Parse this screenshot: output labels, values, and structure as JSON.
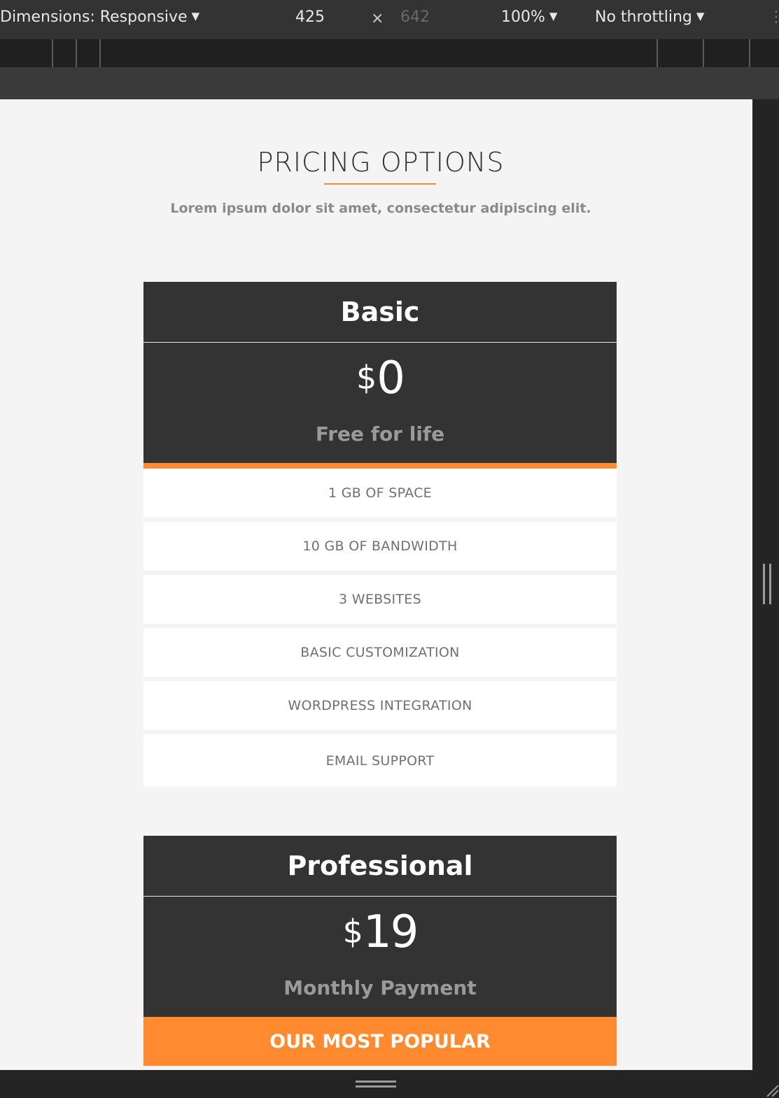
{
  "toolbar": {
    "dimensions_label": "Dimensions: Responsive",
    "width": "425",
    "times": "×",
    "height": "642",
    "zoom": "100%",
    "throttling": "No throttling"
  },
  "page": {
    "title": "PRICING OPTIONS",
    "subtitle": "Lorem ipsum dolor sit amet, consectetur adipiscing elit."
  },
  "plans": [
    {
      "name": "Basic",
      "currency": "$",
      "amount": "0",
      "period": "Free for life",
      "features": [
        "1 GB OF SPACE",
        "10 GB OF BANDWIDTH",
        "3 WEBSITES",
        "BASIC CUSTOMIZATION",
        "WORDPRESS INTEGRATION",
        "EMAIL SUPPORT"
      ]
    },
    {
      "name": "Professional",
      "currency": "$",
      "amount": "19",
      "period": "Monthly Payment",
      "badge": "OUR MOST POPULAR"
    }
  ],
  "colors": {
    "accent": "#ff8a30",
    "card_dark": "#333333",
    "page_bg": "#f4f4f4"
  }
}
